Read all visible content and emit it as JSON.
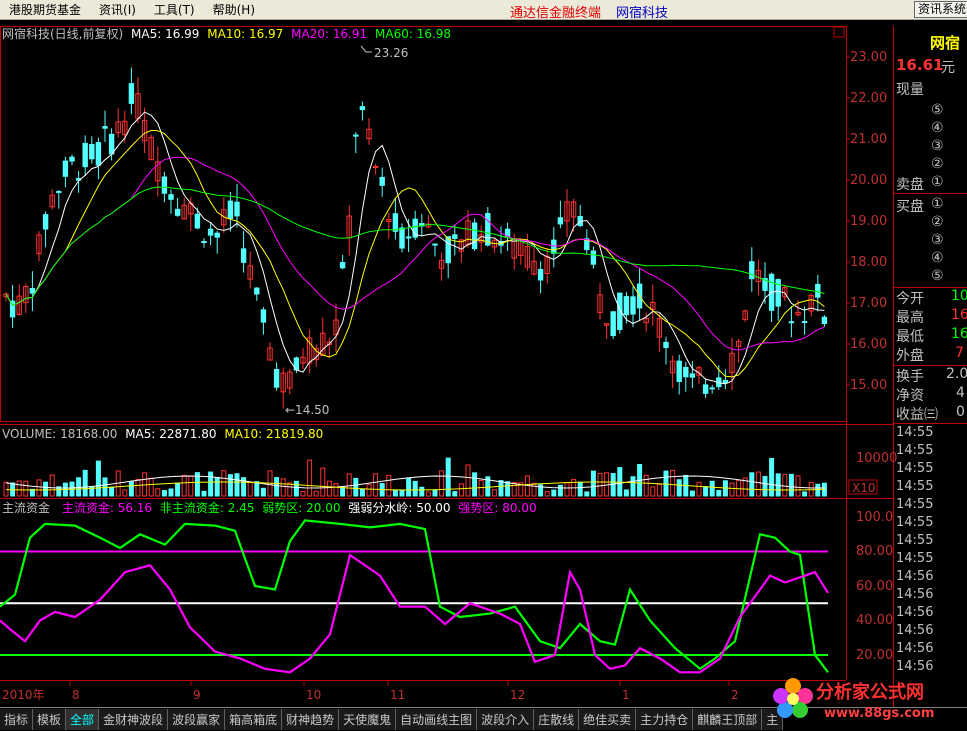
{
  "menu": {
    "items": [
      "港股期货基金",
      "资讯(I)",
      "工具(T)",
      "帮助(H)"
    ],
    "brand": "通达信金融终端",
    "brand_company": "网宿科技",
    "sys_button": "资讯系统"
  },
  "price_panel": {
    "header_name": "网宿科技(日线,前复权)",
    "ma5": "MA5: 16.99",
    "ma10": "MA10: 16.97",
    "ma20": "MA20: 16.91",
    "ma60": "MA60: 16.98",
    "y_ticks": [
      "23.00",
      "22.00",
      "21.00",
      "20.00",
      "19.00",
      "18.00",
      "17.00",
      "16.00",
      "15.00"
    ],
    "high_label": "23.26",
    "low_label": "←14.50",
    "colors": {
      "up": "#ff3232",
      "down": "#54ffff",
      "ma5": "#ffffff",
      "ma10": "#ffff00",
      "ma20": "#ff00ff",
      "ma60": "#00ff00"
    }
  },
  "volume_panel": {
    "vol": "VOLUME: 18168.00",
    "ma5": "MA5: 22871.80",
    "ma10": "MA10: 21819.80",
    "y_tick": "10000",
    "unit": "X10"
  },
  "indicator_panel": {
    "title": "主流资金",
    "main": "主流资金: 56.16",
    "non_main": "非主流资金: 2.45",
    "weak": "弱势区: 20.00",
    "water": "强弱分水岭: 50.00",
    "strong": "强势区: 80.00",
    "y_ticks": [
      "100.0",
      "80.00",
      "60.00",
      "40.00",
      "20.00"
    ]
  },
  "x_axis": {
    "labels": [
      "2010年",
      "8",
      "9",
      "10",
      "11",
      "12",
      "1",
      "2"
    ]
  },
  "right_panel": {
    "stock_name": "网宿",
    "price": "16.61",
    "price_unit": "元",
    "current_volume": "现量",
    "sell_label": "卖盘",
    "buy_label": "买盘",
    "sell_levels": [
      "⑤",
      "④",
      "③",
      "②",
      "①"
    ],
    "buy_levels": [
      "①",
      "②",
      "③",
      "④",
      "⑤"
    ],
    "open_label": "今开",
    "open_val": "10",
    "high_label": "最高",
    "high_val": "16",
    "low_label": "最低",
    "low_val": "16",
    "outer_label": "外盘",
    "outer_val": "7",
    "turnover_label": "换手",
    "turnover_val": "2.0",
    "nav_label": "净资",
    "nav_val": "4",
    "eps_label": "收益㈢",
    "eps_val": "0",
    "tick_times": [
      "14:55",
      "14:55",
      "14:55",
      "14:55",
      "14:55",
      "14:55",
      "14:55",
      "14:55",
      "14:56",
      "14:56",
      "14:56",
      "14:56",
      "14:56",
      "14:56"
    ]
  },
  "bottom_tabs": [
    "指标",
    "模板",
    "全部",
    "金财神波段",
    "波段赢家",
    "箱高箱底",
    "财神趋势",
    "天使魔鬼",
    "自动画线主图",
    "波段介入",
    "庄散线",
    "绝佳买卖",
    "主力持仓",
    "麒麟王顶部",
    "主"
  ],
  "watermark": {
    "title": "分析家公式网",
    "url": "www.88gs.com"
  }
}
